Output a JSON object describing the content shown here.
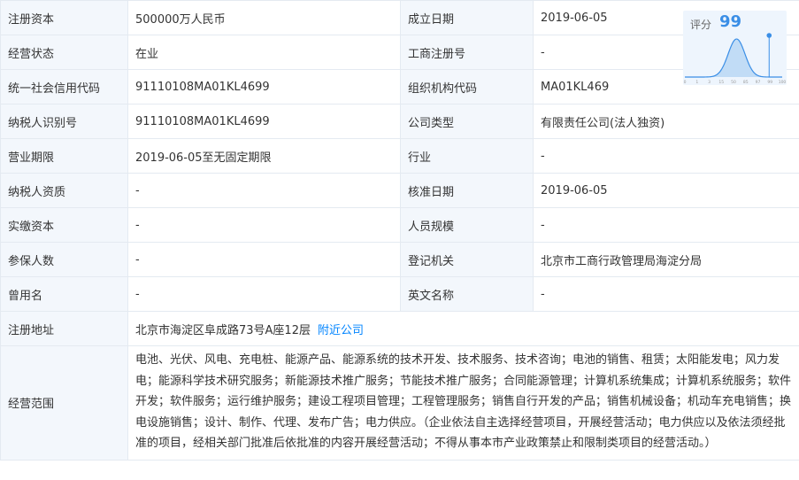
{
  "rows": [
    {
      "l1": "注册资本",
      "v1": "500000万人民币",
      "l2": "成立日期",
      "v2": "2019-06-05"
    },
    {
      "l1": "经营状态",
      "v1": "在业",
      "l2": "工商注册号",
      "v2": "-"
    },
    {
      "l1": "统一社会信用代码",
      "v1": "91110108MA01KL4699",
      "l2": "组织机构代码",
      "v2": "MA01KL469"
    },
    {
      "l1": "纳税人识别号",
      "v1": "91110108MA01KL4699",
      "l2": "公司类型",
      "v2": "有限责任公司(法人独资)"
    },
    {
      "l1": "营业期限",
      "v1": "2019-06-05至无固定期限",
      "l2": "行业",
      "v2": "-"
    },
    {
      "l1": "纳税人资质",
      "v1": "-",
      "l2": "核准日期",
      "v2": "2019-06-05"
    },
    {
      "l1": "实缴资本",
      "v1": "-",
      "l2": "人员规模",
      "v2": "-"
    },
    {
      "l1": "参保人数",
      "v1": "-",
      "l2": "登记机关",
      "v2": "北京市工商行政管理局海淀分局"
    },
    {
      "l1": "曾用名",
      "v1": "-",
      "l2": "英文名称",
      "v2": "-"
    }
  ],
  "address": {
    "label": "注册地址",
    "value": "北京市海淀区阜成路73号A座12层",
    "link": "附近公司"
  },
  "scope": {
    "label": "经营范围",
    "value": "电池、光伏、风电、充电桩、能源产品、能源系统的技术开发、技术服务、技术咨询；电池的销售、租赁；太阳能发电；风力发电；能源科学技术研究服务；新能源技术推广服务；节能技术推广服务；合同能源管理；计算机系统集成；计算机系统服务；软件开发；软件服务；运行维护服务；建设工程项目管理；工程管理服务；销售自行开发的产品；销售机械设备；机动车充电销售；换电设施销售；设计、制作、代理、发布广告；电力供应。（企业依法自主选择经营项目，开展经营活动；电力供应以及依法须经批准的项目，经相关部门批准后依批准的内容开展经营活动；不得从事本市产业政策禁止和限制类项目的经营活动。）"
  },
  "score": {
    "label": "评分",
    "value": "99",
    "value_num": 99,
    "axis_ticks": [
      "0",
      "1",
      "3",
      "15",
      "50",
      "85",
      "97",
      "99",
      "100"
    ],
    "curve_color": "#3a8ee6",
    "fill_color": "#b9d7f4"
  }
}
